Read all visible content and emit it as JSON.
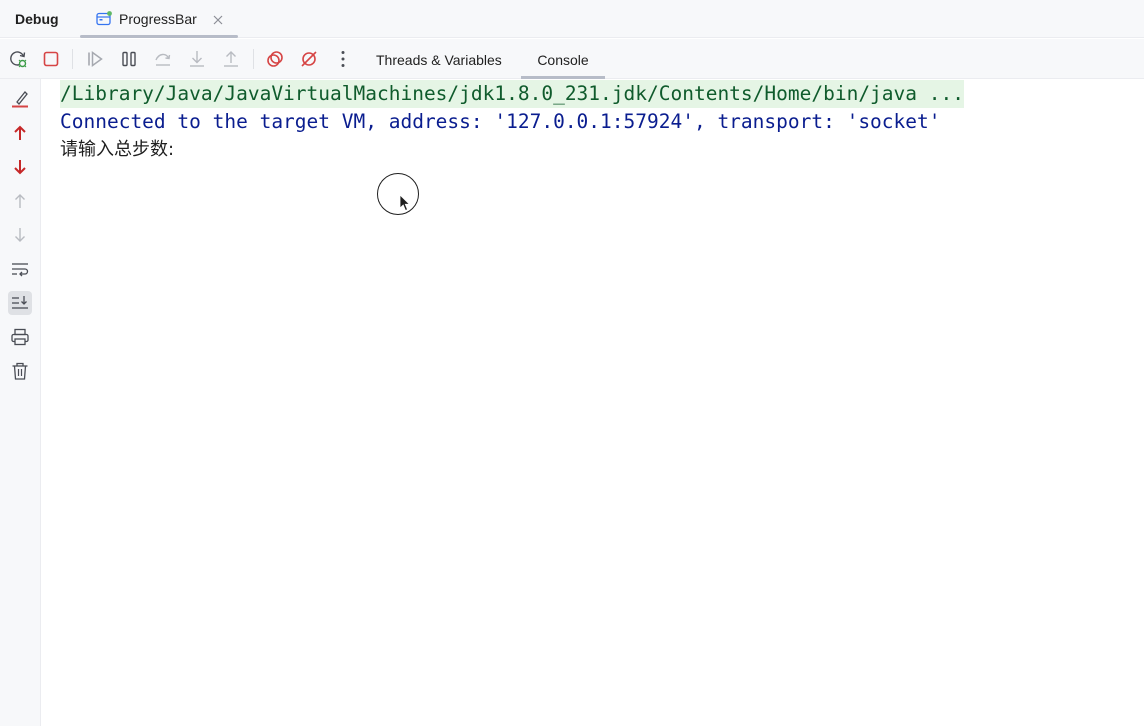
{
  "tool_window": {
    "title": "Debug"
  },
  "run_tab": {
    "label": "ProgressBar",
    "icon": "application-icon",
    "status_color": "#5fb865"
  },
  "toolbar": {
    "buttons": [
      {
        "name": "rerun-debug-icon"
      },
      {
        "name": "stop-icon",
        "color": "#d64545"
      },
      {
        "name": "resume-icon"
      },
      {
        "name": "pause-icon"
      },
      {
        "name": "step-over-icon"
      },
      {
        "name": "step-into-icon"
      },
      {
        "name": "step-out-icon"
      },
      {
        "name": "view-breakpoints-icon",
        "color": "#d64545"
      },
      {
        "name": "mute-breakpoints-icon",
        "color": "#d64545"
      },
      {
        "name": "more-options-icon"
      }
    ],
    "tabs": [
      {
        "label": "Threads & Variables",
        "active": false
      },
      {
        "label": "Console",
        "active": true
      }
    ]
  },
  "gutter": {
    "buttons": [
      {
        "name": "clear-all-icon"
      },
      {
        "name": "previous-occurrence-icon",
        "color": "#c62828"
      },
      {
        "name": "next-occurrence-icon",
        "color": "#c62828"
      },
      {
        "name": "scroll-up-icon"
      },
      {
        "name": "scroll-down-icon"
      },
      {
        "name": "soft-wrap-icon"
      },
      {
        "name": "scroll-to-end-icon",
        "selected": true
      },
      {
        "name": "print-icon"
      },
      {
        "name": "trash-icon"
      }
    ]
  },
  "console": {
    "lines": [
      {
        "text": "/Library/Java/JavaVirtualMachines/jdk1.8.0_231.jdk/Contents/Home/bin/java ...",
        "kind": "command"
      },
      {
        "text": "Connected to the target VM, address: '127.0.0.1:57924', transport: 'socket'",
        "kind": "system"
      },
      {
        "text": "请输入总步数:",
        "kind": "output"
      }
    ]
  },
  "colors": {
    "panel_bg": "#f7f8fa",
    "console_bg": "#ffffff",
    "command_text": "#0f5b2c",
    "command_bg": "#e5f5e5",
    "system_text": "#0a1d8f"
  }
}
